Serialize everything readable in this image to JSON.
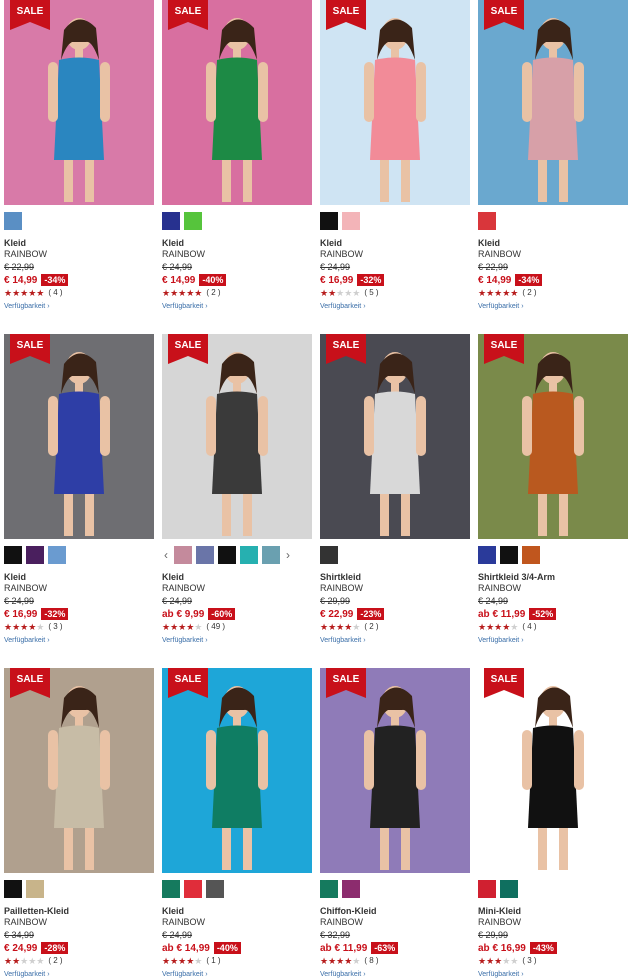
{
  "colors": {
    "sale_red": "#c8101a",
    "link_blue": "#3a6ea8"
  },
  "sale_badge": "SALE",
  "availability_label": "Verfügbarkeit ›",
  "products": [
    {
      "name": "Kleid",
      "brand": "RAINBOW",
      "old_price": "€ 22,99",
      "price": "€ 14,99",
      "discount": "-34%",
      "rating": 5,
      "reviews": "( 4 )",
      "swatch_colors": [
        "#5a8fc4"
      ],
      "bg": "#d87aa8",
      "dress": "#2a86c0",
      "swatch_nav": false
    },
    {
      "name": "Kleid",
      "brand": "RAINBOW",
      "old_price": "€ 24,99",
      "price": "€ 14,99",
      "discount": "-40%",
      "rating": 5,
      "reviews": "( 2 )",
      "swatch_colors": [
        "#27318f",
        "#56c43c"
      ],
      "bg": "#d86fa0",
      "dress": "#1d8a45",
      "swatch_nav": false
    },
    {
      "name": "Kleid",
      "brand": "RAINBOW",
      "old_price": "€ 24,99",
      "price": "€ 16,99",
      "discount": "-32%",
      "rating": 2,
      "reviews": "( 5 )",
      "swatch_colors": [
        "#111111",
        "#f3b4b8"
      ],
      "bg": "#cfe4f3",
      "dress": "#f28b98",
      "swatch_nav": false
    },
    {
      "name": "Kleid",
      "brand": "RAINBOW",
      "old_price": "€ 22,99",
      "price": "€ 14,99",
      "discount": "-34%",
      "rating": 5,
      "reviews": "( 2 )",
      "swatch_colors": [
        "#d9363b"
      ],
      "bg": "#6aa8cf",
      "dress": "#d7a0a8",
      "swatch_nav": false
    },
    {
      "name": "Kleid",
      "brand": "RAINBOW",
      "old_price": "€ 24,99",
      "price": "€ 16,99",
      "discount": "-32%",
      "rating": 4,
      "reviews": "( 3 )",
      "swatch_colors": [
        "#111111",
        "#4a1f5e",
        "#6a9bd0"
      ],
      "bg": "#6e6e72",
      "dress": "#2e3ea6",
      "swatch_nav": false
    },
    {
      "name": "Kleid",
      "brand": "RAINBOW",
      "old_price": "€ 24,99",
      "price": "ab € 9,99",
      "discount": "-60%",
      "rating": 4,
      "reviews": "( 49 )",
      "swatch_colors": [
        "#c48a9c",
        "#6a75a8",
        "#111111",
        "#26b0b0",
        "#6aa0b0"
      ],
      "bg": "#d6d6d6",
      "dress": "#3a3a3a",
      "swatch_nav": true
    },
    {
      "name": "Shirtkleid",
      "brand": "RAINBOW",
      "old_price": "€ 29,99",
      "price": "€ 22,99",
      "discount": "-23%",
      "rating": 4,
      "reviews": "( 2 )",
      "swatch_colors": [
        "#333333"
      ],
      "bg": "#4a4a52",
      "dress": "#d8d8d8",
      "swatch_nav": false
    },
    {
      "name": "Shirtkleid 3/4-Arm",
      "brand": "RAINBOW",
      "old_price": "€ 24,99",
      "price": "ab € 11,99",
      "discount": "-52%",
      "rating": 4,
      "reviews": "( 4 )",
      "swatch_colors": [
        "#2a3a9a",
        "#111111",
        "#c0561e"
      ],
      "bg": "#7a8a4a",
      "dress": "#b9591f",
      "swatch_nav": false
    },
    {
      "name": "Pailletten-Kleid",
      "brand": "RAINBOW",
      "old_price": "€ 34,99",
      "price": "€ 24,99",
      "discount": "-28%",
      "rating": 2,
      "reviews": "( 2 )",
      "swatch_colors": [
        "#111111",
        "#c8b48a"
      ],
      "bg": "#b0a08e",
      "dress": "#c7bca6",
      "swatch_nav": false
    },
    {
      "name": "Kleid",
      "brand": "RAINBOW",
      "old_price": "€ 24,99",
      "price": "ab € 14,99",
      "discount": "-40%",
      "rating": 4,
      "reviews": "( 1 )",
      "swatch_colors": [
        "#157a5e",
        "#e02d3a",
        "#555555"
      ],
      "bg": "#1ea6d8",
      "dress": "#0f7d63",
      "swatch_nav": false
    },
    {
      "name": "Chiffon-Kleid",
      "brand": "RAINBOW",
      "old_price": "€ 32,99",
      "price": "ab € 11,99",
      "discount": "-63%",
      "rating": 4,
      "reviews": "( 8 )",
      "swatch_colors": [
        "#157a5e",
        "#8c2c6e"
      ],
      "bg": "#8f7bb8",
      "dress": "#222222",
      "swatch_nav": false
    },
    {
      "name": "Mini-Kleid",
      "brand": "RAINBOW",
      "old_price": "€ 29,99",
      "price": "ab € 16,99",
      "discount": "-43%",
      "rating": 3,
      "reviews": "( 3 )",
      "swatch_colors": [
        "#d02030",
        "#0f6f5f"
      ],
      "bg": "#ffffff",
      "dress": "#111111",
      "swatch_nav": false
    }
  ]
}
